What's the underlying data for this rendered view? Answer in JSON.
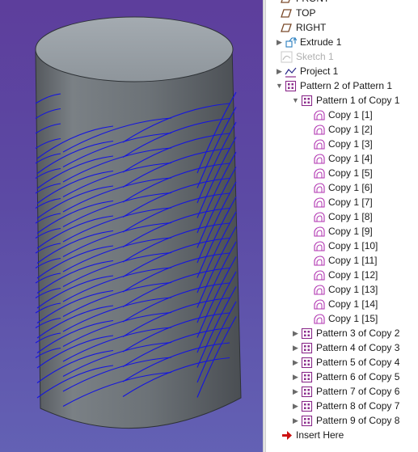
{
  "tree": {
    "items": [
      {
        "label": "FRONT",
        "icon": "datum-plane-icon"
      },
      {
        "label": "TOP",
        "icon": "datum-plane-icon"
      },
      {
        "label": "RIGHT",
        "icon": "datum-plane-icon"
      },
      {
        "label": "Extrude 1",
        "icon": "extrude-icon"
      },
      {
        "label": "Sketch 1",
        "icon": "sketch-icon"
      },
      {
        "label": "Project 1",
        "icon": "project-icon"
      },
      {
        "label": "Pattern 2 of Pattern 1",
        "icon": "pattern-icon"
      },
      {
        "label": "Pattern 1 of Copy 1",
        "icon": "pattern-icon"
      },
      {
        "label": "Copy 1 [1]",
        "icon": "copy-icon"
      },
      {
        "label": "Copy 1 [2]",
        "icon": "copy-icon"
      },
      {
        "label": "Copy 1 [3]",
        "icon": "copy-icon"
      },
      {
        "label": "Copy 1 [4]",
        "icon": "copy-icon"
      },
      {
        "label": "Copy 1 [5]",
        "icon": "copy-icon"
      },
      {
        "label": "Copy 1 [6]",
        "icon": "copy-icon"
      },
      {
        "label": "Copy 1 [7]",
        "icon": "copy-icon"
      },
      {
        "label": "Copy 1 [8]",
        "icon": "copy-icon"
      },
      {
        "label": "Copy 1 [9]",
        "icon": "copy-icon"
      },
      {
        "label": "Copy 1 [10]",
        "icon": "copy-icon"
      },
      {
        "label": "Copy 1 [11]",
        "icon": "copy-icon"
      },
      {
        "label": "Copy 1 [12]",
        "icon": "copy-icon"
      },
      {
        "label": "Copy 1 [13]",
        "icon": "copy-icon"
      },
      {
        "label": "Copy 1 [14]",
        "icon": "copy-icon"
      },
      {
        "label": "Copy 1 [15]",
        "icon": "copy-icon"
      },
      {
        "label": "Pattern 3 of Copy 2",
        "icon": "pattern-icon"
      },
      {
        "label": "Pattern 4 of Copy 3",
        "icon": "pattern-icon"
      },
      {
        "label": "Pattern 5 of Copy 4",
        "icon": "pattern-icon"
      },
      {
        "label": "Pattern 6 of Copy 5",
        "icon": "pattern-icon"
      },
      {
        "label": "Pattern 7 of Copy 6",
        "icon": "pattern-icon"
      },
      {
        "label": "Pattern 8 of Copy 7",
        "icon": "pattern-icon"
      },
      {
        "label": "Pattern 9 of Copy 8",
        "icon": "pattern-icon"
      },
      {
        "label": "Insert Here",
        "icon": "insert-arrow-icon"
      }
    ]
  },
  "colors": {
    "viewport_background": "#5c4aa4",
    "model_body": "#6e7479",
    "model_top": "#9aa2a8",
    "curve": "#1414e0",
    "pattern_icon": "#8a2a8a",
    "insert_arrow": "#cc1111"
  }
}
